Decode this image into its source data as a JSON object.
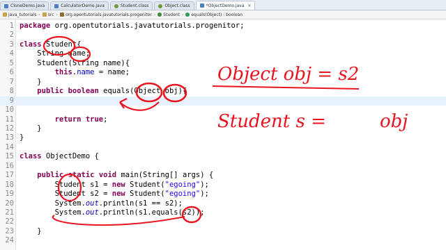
{
  "tabs": [
    {
      "label": "CloneDemo.java",
      "icon": "java-file-icon"
    },
    {
      "label": "CalculatorDemo.java",
      "icon": "java-file-icon"
    },
    {
      "label": "Student.class",
      "icon": "class-file-icon"
    },
    {
      "label": "Object.class",
      "icon": "class-file-icon"
    },
    {
      "label": "*ObjectDemo.java",
      "icon": "java-file-icon",
      "active": true
    }
  ],
  "breadcrumb": [
    {
      "label": "java_tutorials",
      "icon": "project-icon"
    },
    {
      "label": "src",
      "icon": "folder-icon"
    },
    {
      "label": "org.opentutorials.javatutorials.progenitor",
      "icon": "package-icon"
    },
    {
      "label": "Student",
      "icon": "class-icon"
    },
    {
      "label": "equals(Object) : boolean",
      "icon": "method-icon"
    }
  ],
  "code_lines": [
    {
      "n": "1",
      "text": "package org.opentutorials.javatutorials.progenitor;"
    },
    {
      "n": "2",
      "text": ""
    },
    {
      "n": "3",
      "text": "class Student{"
    },
    {
      "n": "4",
      "text": "    String name;"
    },
    {
      "n": "5",
      "text": "    Student(String name){"
    },
    {
      "n": "6",
      "text": "        this.name = name;"
    },
    {
      "n": "7",
      "text": "    }"
    },
    {
      "n": "8",
      "text": "    public boolean equals(Object obj){"
    },
    {
      "n": "9",
      "text": ""
    },
    {
      "n": "10",
      "text": ""
    },
    {
      "n": "11",
      "text": "        return true;"
    },
    {
      "n": "12",
      "text": "    }"
    },
    {
      "n": "13",
      "text": "}"
    },
    {
      "n": "14",
      "text": ""
    },
    {
      "n": "15",
      "text": "class ObjectDemo {"
    },
    {
      "n": "16",
      "text": ""
    },
    {
      "n": "17",
      "text": "    public static void main(String[] args) {"
    },
    {
      "n": "18",
      "text": "        Student s1 = new Student(\"egoing\");"
    },
    {
      "n": "19",
      "text": "        Student s2 = new Student(\"egoing\");"
    },
    {
      "n": "20",
      "text": "        System.out.println(s1 == s2);"
    },
    {
      "n": "21",
      "text": "        System.out.println(s1.equals(s2));"
    },
    {
      "n": "22",
      "text": ""
    },
    {
      "n": "23",
      "text": "    }"
    },
    {
      "n": "24",
      "text": ""
    }
  ],
  "annotations": {
    "line1": "Object  obj = s2",
    "line2": "Student  s  =",
    "line3": "obj"
  },
  "colors": {
    "keyword": "#7f0055",
    "field": "#0000c0",
    "string": "#2a00ff",
    "ink": "#e8141e",
    "current_line": "#e8f2fe"
  }
}
